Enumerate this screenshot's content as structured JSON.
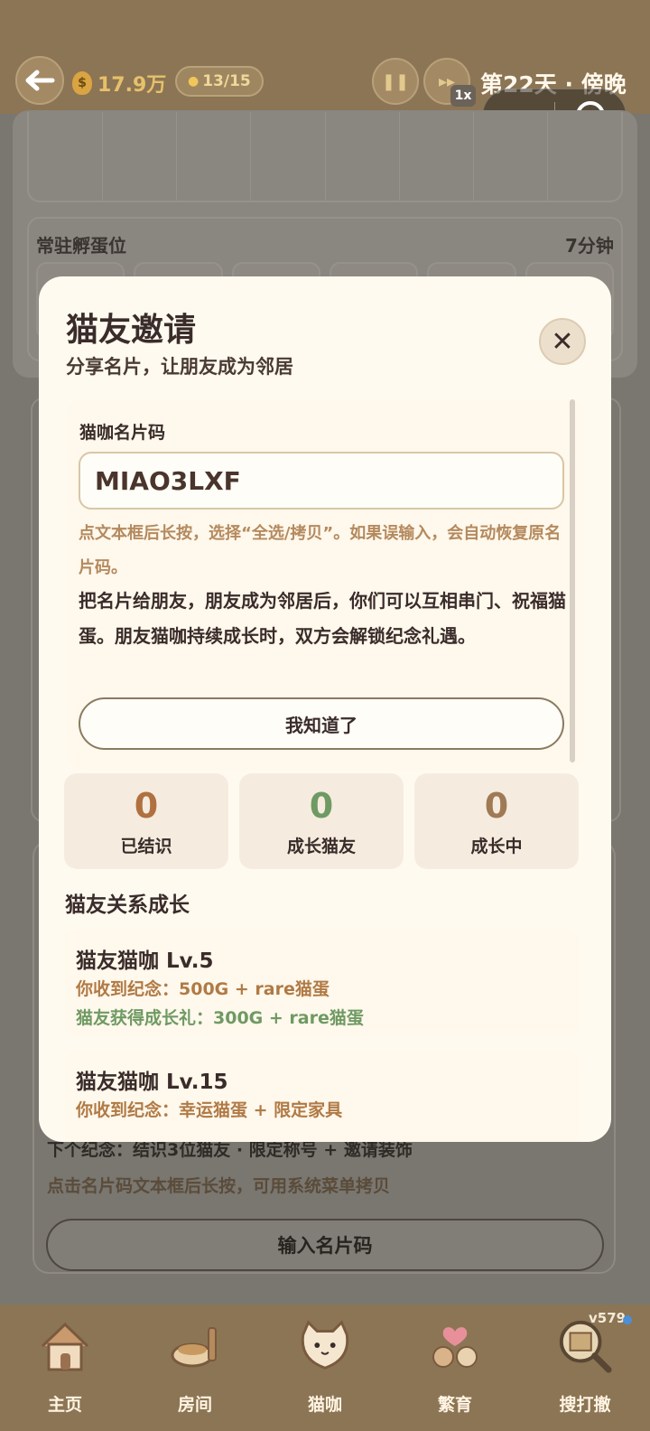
{
  "header": {
    "coins": "17.9万",
    "cat_count": "13/15",
    "speed": "1x",
    "day_label": "第22天 · 傍晚"
  },
  "background": {
    "incubate_title": "常驻孵蛋位",
    "incubate_time": "7分钟",
    "next_reward": "下个纪念：结识3位猫友 · 限定称号 + 邀请装饰",
    "copy_hint": "点击名片码文本框后长按，可用系统菜单拷贝",
    "input_code_button": "输入名片码"
  },
  "modal": {
    "title": "猫友邀请",
    "subtitle": "分享名片，让朋友成为邻居",
    "card_label": "猫咖名片码",
    "card_code": "MIAO3LXF",
    "hint": "点文本框后长按，选择“全选/拷贝”。如果误输入，会自动恢复原名片码。",
    "description": "把名片给朋友，朋友成为邻居后，你们可以互相串门、祝福猫蛋。朋友猫咖持续成长时，双方会解锁纪念礼遇。",
    "ok_button": "我知道了",
    "stats": [
      {
        "value": "0",
        "label": "已结识",
        "color": "#b07040"
      },
      {
        "value": "0",
        "label": "成长猫友",
        "color": "#6f9a63"
      },
      {
        "value": "0",
        "label": "成长中",
        "color": "#a07a55"
      }
    ],
    "section_title": "猫友关系成长",
    "tiers": [
      {
        "title": "猫友猫咖 Lv.5",
        "receive": "你收到纪念：500G + rare猫蛋",
        "gain": "猫友获得成长礼：300G + rare猫蛋"
      },
      {
        "title": "猫友猫咖 Lv.15",
        "receive": "你收到纪念：幸运猫蛋 + 限定家具",
        "gain": ""
      }
    ]
  },
  "nav": {
    "items": [
      {
        "label": "主页",
        "icon": "house-icon"
      },
      {
        "label": "房间",
        "icon": "room-icon"
      },
      {
        "label": "猫咖",
        "icon": "cat-cafe-icon"
      },
      {
        "label": "繁育",
        "icon": "breeding-icon"
      },
      {
        "label": "搜打撤",
        "icon": "search-map-icon"
      }
    ],
    "version": "v579"
  }
}
